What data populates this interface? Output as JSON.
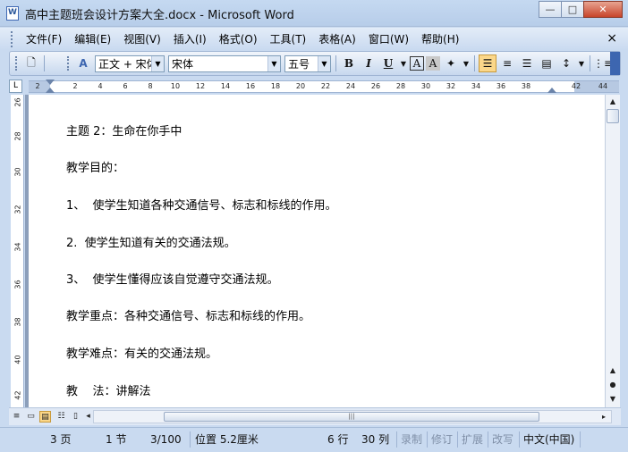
{
  "window": {
    "title": "高中主题班会设计方案大全.docx - Microsoft Word",
    "min": "—",
    "max": "□",
    "close": "✕"
  },
  "menu": [
    "文件(F)",
    "编辑(E)",
    "视图(V)",
    "插入(I)",
    "格式(O)",
    "工具(T)",
    "表格(A)",
    "窗口(W)",
    "帮助(H)"
  ],
  "menu_close": "×",
  "toolbar": {
    "style": "正文 + 宋体",
    "font": "宋体",
    "size": "五号",
    "bold": "B",
    "italic": "I",
    "underline": "U",
    "font_color": "A",
    "char_shading": "A",
    "highlight": "A"
  },
  "ruler": {
    "ticks": [
      "2",
      "2",
      "4",
      "6",
      "8",
      "10",
      "12",
      "14",
      "16",
      "18",
      "20",
      "22",
      "24",
      "26",
      "28",
      "30",
      "32",
      "34",
      "36",
      "38",
      "42",
      "44"
    ],
    "corner": "L"
  },
  "vruler": {
    "ticks": [
      "26",
      "28",
      "30",
      "32",
      "34",
      "36",
      "38",
      "40",
      "42"
    ]
  },
  "document": {
    "paragraphs": [
      "主题 2：生命在你手中",
      "教学目的：",
      "1、  使学生知道各种交通信号、标志和标线的作用。",
      "2.  使学生知道有关的交通法规。",
      "3、  使学生懂得应该自觉遵守交通法规。",
      "教学重点：各种交通信号、标志和标线的作用。",
      "教学难点：有关的交通法规。",
      "教    法：讲解法"
    ]
  },
  "status": {
    "page": "3 页",
    "section": "1 节",
    "page_of": "3/100",
    "position": "位置 5.2厘米",
    "line": "6 行",
    "column": "30 列",
    "rec": "录制",
    "trk": "修订",
    "ext": "扩展",
    "ovr": "改写",
    "lang": "中文(中国)"
  }
}
